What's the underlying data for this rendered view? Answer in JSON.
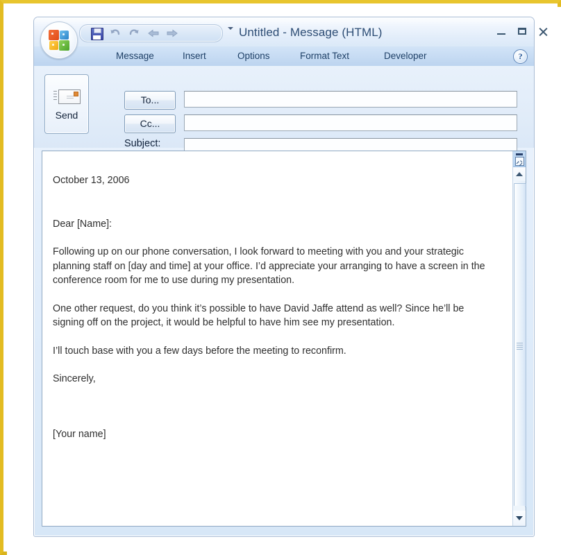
{
  "window": {
    "title": "Untitled - Message (HTML)",
    "orb_name": "office-button",
    "minimize_label": "Minimize",
    "maximize_label": "Maximize",
    "close_label": "Close"
  },
  "quick_access": {
    "items": [
      {
        "name": "save-icon",
        "label": "Save"
      },
      {
        "name": "undo-icon",
        "label": "Undo",
        "glyph": "↶"
      },
      {
        "name": "redo-icon",
        "label": "Redo",
        "glyph": "↷"
      },
      {
        "name": "previous-item-icon",
        "label": "Previous Item",
        "glyph": "⇦"
      },
      {
        "name": "next-item-icon",
        "label": "Next Item",
        "glyph": "⇨"
      }
    ],
    "dropdown_label": "Customize Quick Access Toolbar"
  },
  "ribbon": {
    "tabs": [
      {
        "label": "Message"
      },
      {
        "label": "Insert"
      },
      {
        "label": "Options"
      },
      {
        "label": "Format Text"
      },
      {
        "label": "Developer"
      }
    ],
    "help_glyph": "?",
    "help_label": "Help"
  },
  "header": {
    "send_label": "Send",
    "to_button": "To...",
    "cc_button": "Cc...",
    "subject_label": "Subject:",
    "to_value": "",
    "cc_value": "",
    "subject_value": "",
    "to_placeholder": "",
    "cc_placeholder": "",
    "subject_placeholder": ""
  },
  "body": {
    "date": "October 13, 2006",
    "salutation": "Dear [Name]:",
    "paragraph_1": "Following up on our phone conversation, I look forward to meeting with you and your strategic planning staff on [day and time] at your office. I’d appreciate your arranging to have a screen in the conference room for me to use during my presentation.",
    "paragraph_2": "One other request, do you think it’s possible to have David Jaffe attend as well? Since he’ll be signing off on the project, it would be helpful to have him see my presentation.",
    "paragraph_3": "I’ll touch base with you a few days before the meeting to reconfirm.",
    "closing": "Sincerely,",
    "signature": "[Your name]",
    "watermark": ""
  },
  "scrollbar": {
    "split_label": "Split",
    "up_label": "Scroll Up",
    "down_label": "Scroll Down",
    "thumb_label": "Scroll Thumb"
  },
  "colors": {
    "frame": "#e3bc22",
    "title_text": "#2c4c74",
    "tab_text": "#1d3f66",
    "body_text": "#2f2f2f",
    "ribbon_bg": "#c6dbf3"
  }
}
